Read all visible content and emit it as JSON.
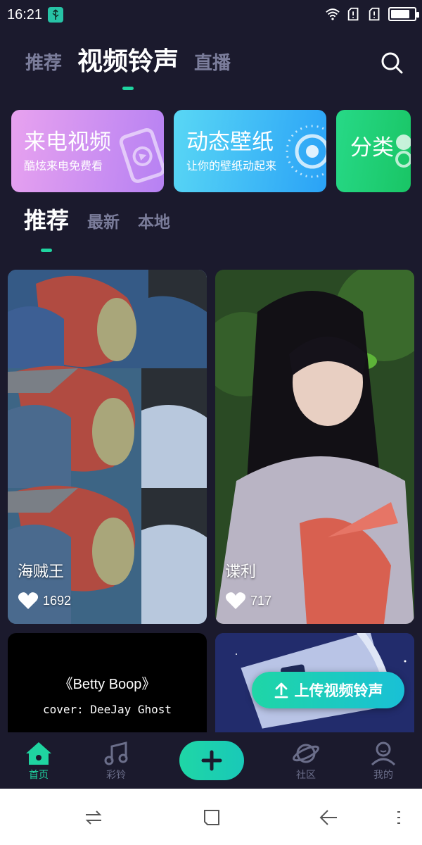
{
  "status_bar": {
    "time": "16:21",
    "usb_icon": "usb-icon",
    "icons": [
      "wifi-icon",
      "sim-no-signal-icon",
      "sim-no-signal-icon",
      "battery-charging-icon"
    ],
    "battery_level": 0.8
  },
  "top_tabs": [
    {
      "label": "推荐",
      "active": false
    },
    {
      "label": "视频铃声",
      "active": true
    },
    {
      "label": "直播",
      "active": false
    }
  ],
  "search_icon": "search-icon",
  "feature_cards": [
    {
      "title": "来电视频",
      "subtitle": "酷炫来电免费看",
      "color": "#c68ff2"
    },
    {
      "title": "动态壁纸",
      "subtitle": "让你的壁纸动起来",
      "color": "#3eb7f6"
    },
    {
      "title": "分类",
      "subtitle": "",
      "color": "#20d07a"
    }
  ],
  "sub_tabs": [
    {
      "label": "推荐",
      "active": true
    },
    {
      "label": "最新",
      "active": false
    },
    {
      "label": "本地",
      "active": false
    }
  ],
  "videos": [
    {
      "name": "海贼王",
      "likes": "1692"
    },
    {
      "name": "谍利",
      "likes": "717"
    },
    {
      "name": "",
      "likes": "",
      "title_text": "《Betty Boop》",
      "cover_text": "cover:  DeeJay Ghost"
    },
    {
      "name": "",
      "likes": ""
    }
  ],
  "upload_button": {
    "label": "上传视频铃声"
  },
  "bottom_nav": [
    {
      "label": "首页",
      "icon": "home-icon",
      "active": true
    },
    {
      "label": "彩铃",
      "icon": "music-note-icon",
      "active": false
    },
    {
      "label": "",
      "icon": "plus-icon",
      "active": false
    },
    {
      "label": "社区",
      "icon": "planet-icon",
      "active": false
    },
    {
      "label": "我的",
      "icon": "user-icon",
      "active": false
    }
  ],
  "accent_color": "#1fd4a0",
  "background_color": "#1b1a2d"
}
